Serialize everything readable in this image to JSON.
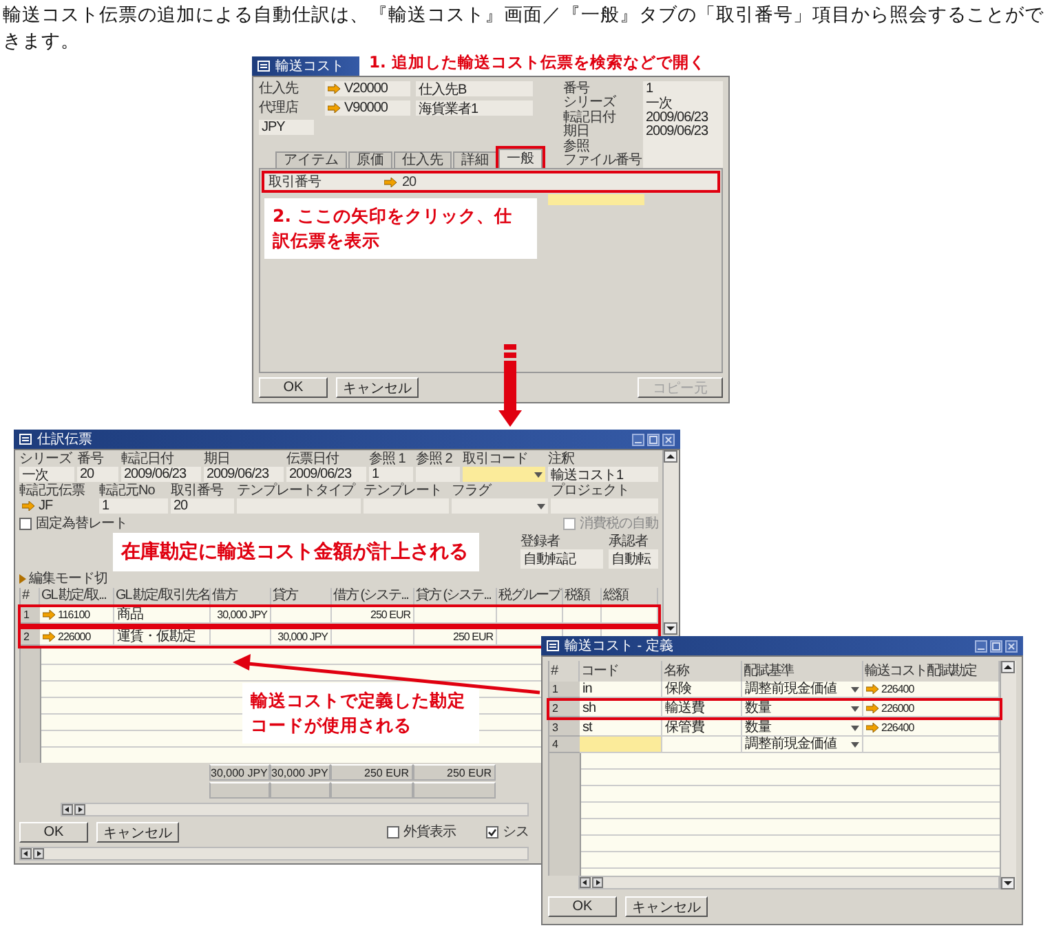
{
  "intro": "輸送コスト伝票の追加による自動仕訳は、『輸送コスト』画面／『一般』タブの「取引番号」項目から照会することができます。",
  "notes": [
    {
      "text": "1. 追加した輸送コスト伝票を検索などで開く",
      "kind": "plain"
    },
    {
      "text": "2. ここの矢印をクリック、仕訳伝票を表示",
      "kind": "box"
    },
    {
      "text": "在庫勘定に輸送コスト金額が計上される",
      "kind": "box"
    },
    {
      "text": "輸送コストで定義した勘定コードが使用される",
      "kind": "box"
    }
  ],
  "freight_cost_window": {
    "title": "輸送コスト",
    "left_fields": [
      {
        "label": "仕入先",
        "code": "V20000",
        "name": "仕入先B"
      },
      {
        "label": "代理店",
        "code": "V90000",
        "name": "海貨業者1"
      }
    ],
    "currency": "JPY",
    "right_fields": [
      {
        "label": "番号",
        "value": "1"
      },
      {
        "label": "シリーズ",
        "value": "一次"
      },
      {
        "label": "転記日付",
        "value": "2009/06/23"
      },
      {
        "label": "期日",
        "value": "2009/06/23"
      },
      {
        "label": "参照"
      },
      {
        "label": "ファイル番号"
      }
    ],
    "tabs": [
      {
        "label": "アイテム",
        "selected": false
      },
      {
        "label": "原価",
        "selected": false
      },
      {
        "label": "仕入先",
        "selected": false
      },
      {
        "label": "詳細",
        "selected": false
      },
      {
        "label": "一般",
        "selected": true
      }
    ],
    "general_fields": [
      {
        "label": "取引番号",
        "value": "20",
        "highlighted": true
      }
    ],
    "buttons": [
      {
        "label": "OK",
        "disabled": false
      },
      {
        "label": "キャンセル",
        "disabled": false
      },
      {
        "label": "コピー元",
        "disabled": true
      }
    ]
  },
  "journal_window": {
    "title": "仕訳伝票",
    "header": [
      {
        "label": "シリーズ",
        "value": "一次",
        "kind": "text"
      },
      {
        "label": "番号",
        "value": "20",
        "kind": "text"
      },
      {
        "label": "転記日付",
        "value": "2009/06/23",
        "kind": "text"
      },
      {
        "label": "期日",
        "value": "2009/06/23",
        "kind": "text"
      },
      {
        "label": "伝票日付",
        "value": "2009/06/23",
        "kind": "text"
      },
      {
        "label": "参照 1",
        "value": "1",
        "kind": "text"
      },
      {
        "label": "参照 2",
        "kind": "text"
      },
      {
        "label": "取引コード",
        "kind": "dropdown"
      },
      {
        "label": "注釈",
        "value": "輸送コスト1",
        "kind": "text"
      }
    ],
    "source": [
      {
        "label": "転記元伝票",
        "value": "JF",
        "kind": "link"
      },
      {
        "label": "転記元No",
        "value": "1",
        "kind": "text"
      },
      {
        "label": "取引番号",
        "value": "20",
        "kind": "text"
      },
      {
        "label": "テンプレートタイプ",
        "kind": "text"
      },
      {
        "label": "テンプレート",
        "kind": "text"
      },
      {
        "label": "フラグ",
        "kind": "dropdown"
      },
      {
        "label": "プロジェクト",
        "kind": "text"
      }
    ],
    "fixed_rate": {
      "label": "固定為替レート",
      "checked": false
    },
    "auto_tax": {
      "label": "消費税の自動",
      "checked": false
    },
    "approvals": [
      {
        "label": "登録者",
        "value": "自動転記"
      },
      {
        "label": "承認者",
        "value": "自動転"
      }
    ],
    "edit_mode": "編集モード切",
    "columns": [
      "#",
      "GL 勘定/取...",
      "GL 勘定/取引先名",
      "借方",
      "貸方",
      "借方 (システ...",
      "貸方 (システ...",
      "税グループ",
      "税額",
      "総額"
    ],
    "rows": [
      {
        "number": "1",
        "account": "116100",
        "name": "商品",
        "debit": "30,000 JPY",
        "debit_sys": "250 EUR",
        "highlighted": true
      },
      {
        "number": "2",
        "account": "226000",
        "name": "運賃・仮勘定",
        "credit": "30,000 JPY",
        "credit_sys": "250 EUR",
        "highlighted": true
      }
    ],
    "totals": [
      "30,000 JPY",
      "30,000 JPY",
      "250 EUR",
      "250 EUR"
    ],
    "buttons": [
      "OK",
      "キャンセル"
    ],
    "options": [
      {
        "label": "外貨表示",
        "checked": false
      },
      {
        "label": "シス",
        "checked": true
      }
    ]
  },
  "definition_window": {
    "title": "輸送コスト - 定義",
    "columns": [
      "#",
      "コード",
      "名称",
      "配賦基準",
      "輸送コスト配賦勘定"
    ],
    "rows": [
      {
        "number": "1",
        "code": "in",
        "name": "保険",
        "basis": "調整前現金価値",
        "account": "226400",
        "highlighted": false,
        "editing": false
      },
      {
        "number": "2",
        "code": "sh",
        "name": "輸送費",
        "basis": "数量",
        "account": "226000",
        "highlighted": true,
        "editing": false
      },
      {
        "number": "3",
        "code": "st",
        "name": "保管費",
        "basis": "数量",
        "account": "226400",
        "highlighted": false,
        "editing": false
      },
      {
        "number": "4",
        "basis": "調整前現金価値",
        "highlighted": false,
        "editing": true
      }
    ],
    "buttons": [
      "OK",
      "キャンセル"
    ]
  }
}
